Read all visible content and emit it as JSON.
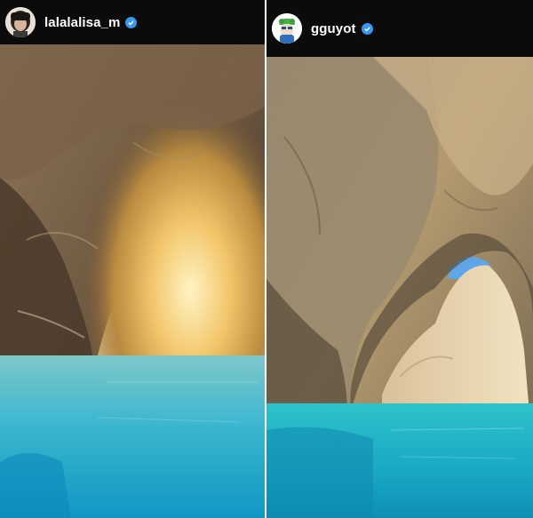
{
  "posts": [
    {
      "username": "lalalalisa_m",
      "avatar_icon": "profile-photo-avatar",
      "verified_icon": "verified-badge-icon",
      "photo_subject": "sea-cave-photo",
      "colors": {
        "water": "#16a7c9",
        "rock": "#6b5640",
        "light": "#f5d07a"
      }
    },
    {
      "username": "gguyot",
      "avatar_icon": "cartoon-avatar",
      "verified_icon": "verified-badge-icon",
      "photo_subject": "rock-arch-photo",
      "colors": {
        "water": "#19b3c7",
        "rock": "#8a7a62",
        "sky": "#5fa6e8"
      }
    }
  ],
  "colors": {
    "header_bg": "#0b0b0b",
    "username": "#ffffff",
    "verified": "#3897f0"
  }
}
